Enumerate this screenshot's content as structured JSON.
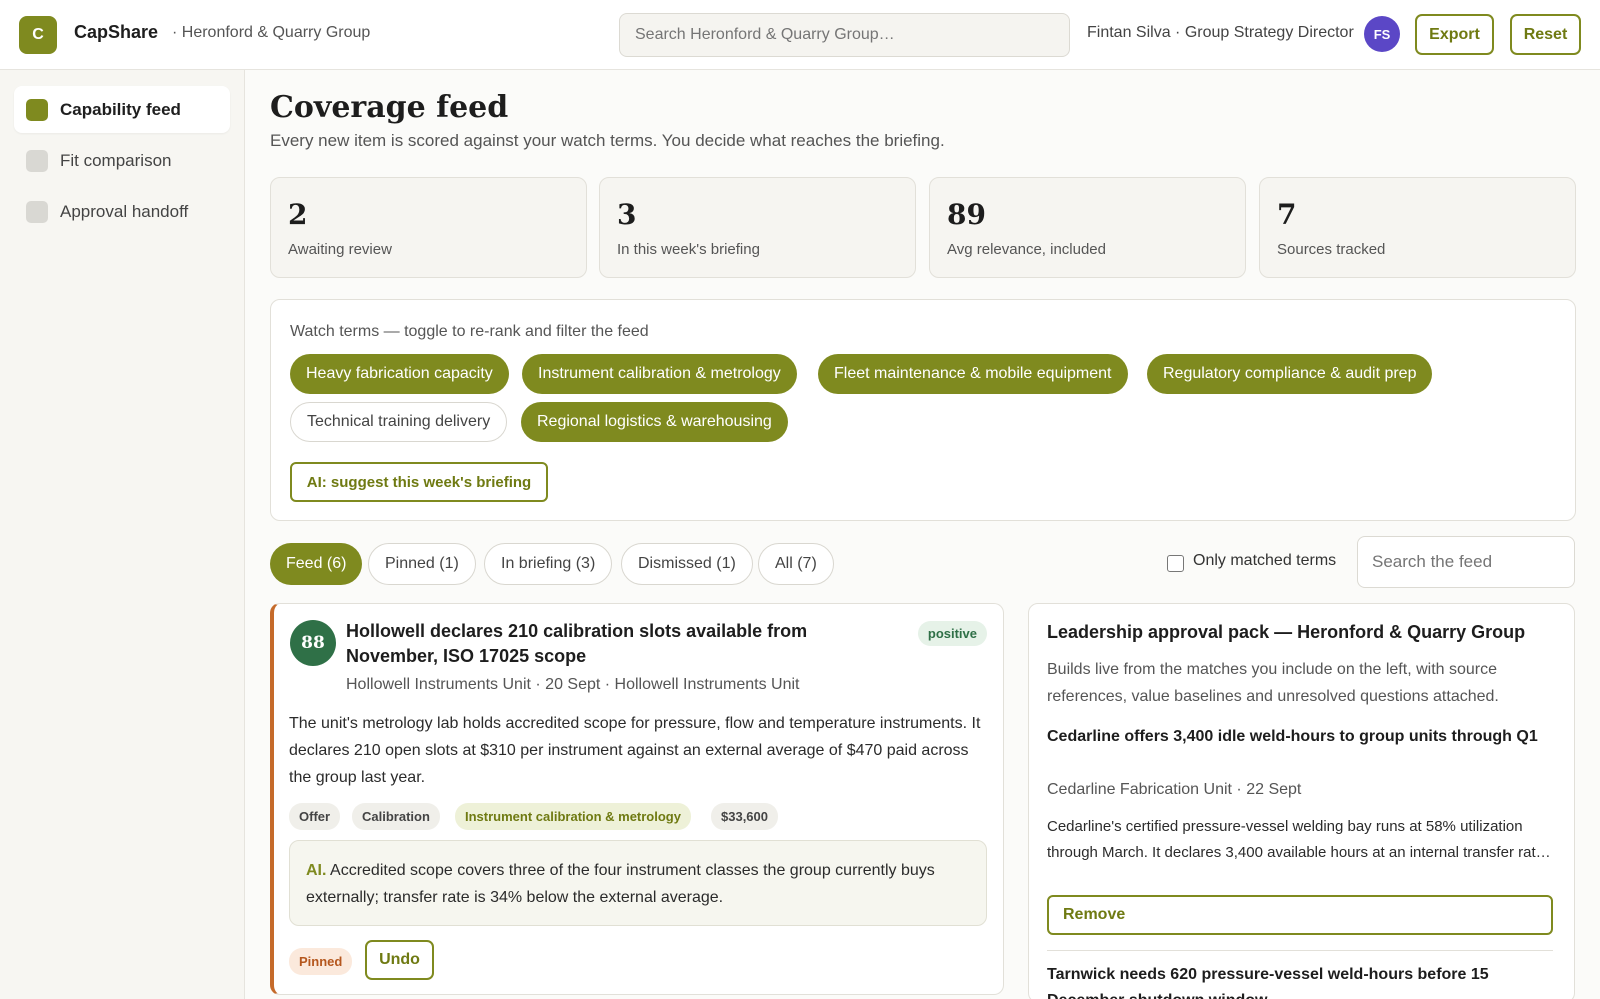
{
  "app": {
    "logo_letter": "C",
    "name": "CapShare",
    "org": "· Heronford & Quarry Group"
  },
  "search": {
    "placeholder": "Search Heronford & Quarry Group…"
  },
  "user": {
    "label": "Fintan Silva · Group Strategy Director",
    "initials": "FS"
  },
  "header_buttons": {
    "export": "Export",
    "reset": "Reset"
  },
  "sidebar": {
    "items": [
      {
        "label": "Capability feed",
        "active": true
      },
      {
        "label": "Fit comparison",
        "active": false
      },
      {
        "label": "Approval handoff",
        "active": false
      }
    ]
  },
  "page": {
    "title": "Coverage feed",
    "subtitle": "Every new item is scored against your watch terms. You decide what reaches the briefing."
  },
  "stats": [
    {
      "value": "2",
      "label": "Awaiting review"
    },
    {
      "value": "3",
      "label": "In this week's briefing"
    },
    {
      "value": "89",
      "label": "Avg relevance, included"
    },
    {
      "value": "7",
      "label": "Sources tracked"
    }
  ],
  "watch": {
    "title": "Watch terms — toggle to re-rank and filter the feed",
    "terms": [
      {
        "label": "Heavy fabrication capacity",
        "on": true
      },
      {
        "label": "Instrument calibration & metrology",
        "on": true
      },
      {
        "label": "Fleet maintenance & mobile equipment",
        "on": true
      },
      {
        "label": "Regulatory compliance & audit prep",
        "on": true
      },
      {
        "label": "Technical training delivery",
        "on": false
      },
      {
        "label": "Regional logistics & warehousing",
        "on": true
      }
    ],
    "ai_button": "AI: suggest this week's briefing"
  },
  "tabs": [
    {
      "label": "Feed (6)",
      "active": true
    },
    {
      "label": "Pinned (1)",
      "active": false
    },
    {
      "label": "In briefing (3)",
      "active": false
    },
    {
      "label": "Dismissed (1)",
      "active": false
    },
    {
      "label": "All (7)",
      "active": false
    }
  ],
  "filter": {
    "only_matched_label": "Only matched terms",
    "only_matched_checked": false,
    "search_placeholder": "Search the feed"
  },
  "feed_item": {
    "score": "88",
    "title": "Hollowell declares 210 calibration slots available from November, ISO 17025 scope",
    "sentiment": "positive",
    "meta": "Hollowell Instruments Unit · 20 Sept · Hollowell Instruments Unit",
    "body": "The unit's metrology lab holds accredited scope for pressure, flow and temperature instruments. It declares 210 open slots at $310 per instrument against an external average of $470 paid across the group last year.",
    "tags": [
      "Offer",
      "Calibration",
      "Instrument calibration & metrology",
      "$33,600"
    ],
    "ai_label": "AI.",
    "ai_text": "Accredited scope covers three of the four instrument classes the group currently buys externally; transfer rate is 34% below the external average.",
    "status_badge": "Pinned",
    "undo": "Undo"
  },
  "approval_pack": {
    "title": "Leadership approval pack — Heronford & Quarry Group",
    "description": "Builds live from the matches you include on the left, with source references, value baselines and unresolved questions attached.",
    "items": [
      {
        "title": "Cedarline offers 3,400 idle weld-hours to group units through Q1",
        "meta": "Cedarline Fabrication Unit · 22 Sept",
        "body": "Cedarline's certified pressure-vessel welding bay runs at 58% utilization through March. It declares 3,400 available hours at an internal transfer rat…",
        "action": "Remove"
      },
      {
        "title": "Tarnwick needs 620 pressure-vessel weld-hours before 15 December shutdown window"
      }
    ]
  },
  "colors": {
    "accent": "#7f8a1f",
    "score": "#2f7047",
    "pinned_border": "#c56a2a",
    "avatar": "#5b47c6"
  }
}
